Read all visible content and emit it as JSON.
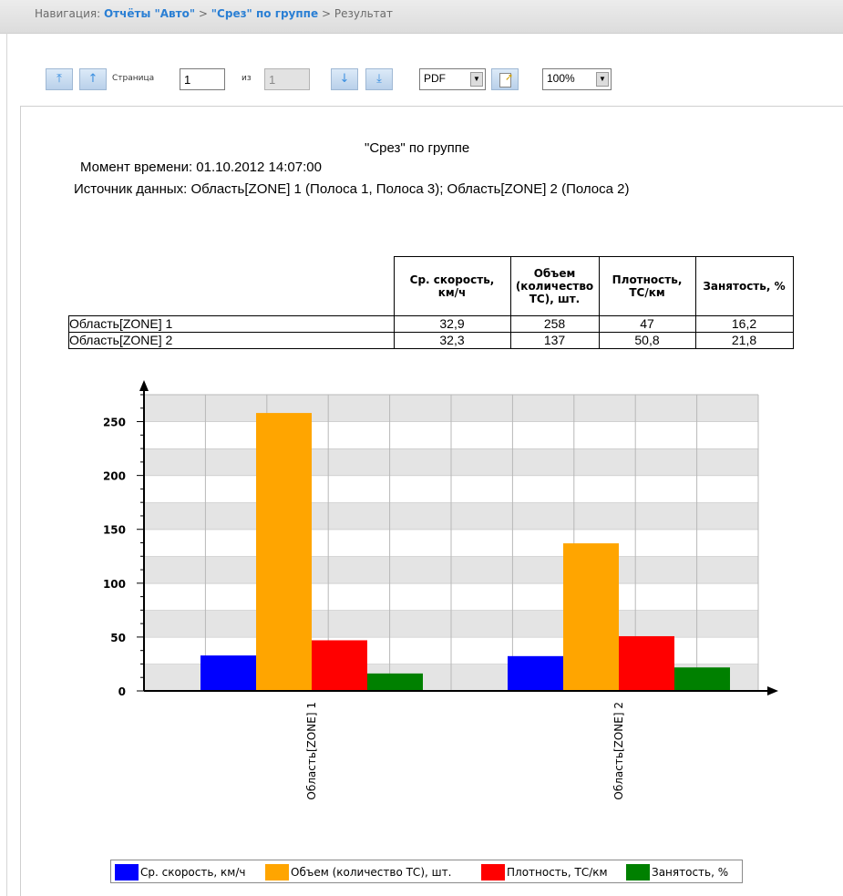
{
  "navigation": {
    "prefix": "Навигация:",
    "crumb1": "Отчёты \"Авто\"",
    "sep1": ">",
    "crumb2": "\"Срез\" по группе",
    "sep2": ">",
    "current": "Результат"
  },
  "toolbar": {
    "first_icon": "first-page-icon",
    "prev_icon": "prev-page-icon",
    "page_label": "Страница",
    "page_value": "1",
    "of_label": "из",
    "total_pages": "1",
    "next_icon": "next-page-icon",
    "last_icon": "last-page-icon",
    "format_value": "PDF",
    "export_icon": "export-icon",
    "zoom_value": "100%"
  },
  "report": {
    "title": "\"Срез\" по группе",
    "time_label": "Момент времени:",
    "time_value": "01.10.2012 14:07:00",
    "source_label": "Источник данных:",
    "source_value": "Область[ZONE] 1 (Полоса 1, Полоса 3); Область[ZONE] 2 (Полоса 2)"
  },
  "table": {
    "headers": [
      "Ср. скорость, км/ч",
      "Объем (количество ТС), шт.",
      "Плотность, ТС/км",
      "Занятость, %"
    ],
    "header_lines": [
      [
        "Ср. скорость,",
        "км/ч"
      ],
      [
        "Объем",
        "(количество",
        "ТС), шт."
      ],
      [
        "Плотность,",
        "ТС/км"
      ],
      [
        "Занятость, %"
      ]
    ],
    "rows": [
      {
        "name": "Область[ZONE] 1",
        "values": [
          "32,9",
          "258",
          "47",
          "16,2"
        ]
      },
      {
        "name": "Область[ZONE] 2",
        "values": [
          "32,3",
          "137",
          "50,8",
          "21,8"
        ]
      }
    ]
  },
  "chart_data": {
    "type": "bar",
    "categories": [
      "Область[ZONE] 1",
      "Область[ZONE] 2"
    ],
    "series": [
      {
        "name": "Ср. скорость, км/ч",
        "values": [
          32.9,
          32.3
        ],
        "color": "#0000ff"
      },
      {
        "name": "Объем (количество ТС), шт.",
        "values": [
          258,
          137
        ],
        "color": "#ffa500"
      },
      {
        "name": "Плотность, ТС/км",
        "values": [
          47,
          50.8
        ],
        "color": "#ff0000"
      },
      {
        "name": "Занятость, %",
        "values": [
          16.2,
          21.8
        ],
        "color": "#008000"
      }
    ],
    "y_ticks": [
      0,
      50,
      100,
      150,
      200,
      250
    ],
    "ylim": [
      0,
      275
    ],
    "grid": true,
    "legend_position": "bottom"
  },
  "colors": {
    "nav_link": "#2a7fd4",
    "grid_band": "#e4e4e4"
  }
}
